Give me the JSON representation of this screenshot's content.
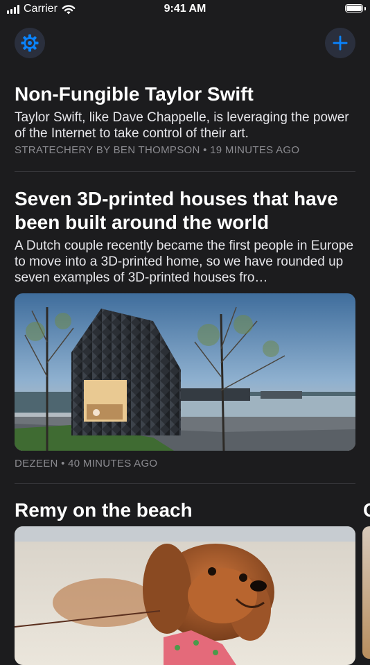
{
  "status_bar": {
    "carrier": "Carrier",
    "time": "9:41 AM",
    "wifi_icon": "wifi-icon",
    "battery_icon": "battery-icon"
  },
  "header": {
    "settings_icon": "gear-icon",
    "add_icon": "plus-icon",
    "accent_color": "#0a84ff"
  },
  "articles": [
    {
      "title": "Non-Fungible Taylor Swift",
      "summary": "Taylor Swift, like Dave Chappelle, is leveraging the power of the Internet to take control of their art.",
      "source": "STRATECHERY BY BEN THOMPSON",
      "separator": "•",
      "age": "19 MINUTES AGO"
    },
    {
      "title": "Seven 3D-printed houses that have been built around the world",
      "summary": "A Dutch couple recently became the first people in Europe to move into a 3D-printed home, so we have rounded up seven examples of 3D-printed houses fro…",
      "source": "DEZEEN",
      "separator": "•",
      "age": "40 MINUTES AGO"
    },
    {
      "title": "Remy on the beach",
      "peek_title": "C"
    }
  ]
}
